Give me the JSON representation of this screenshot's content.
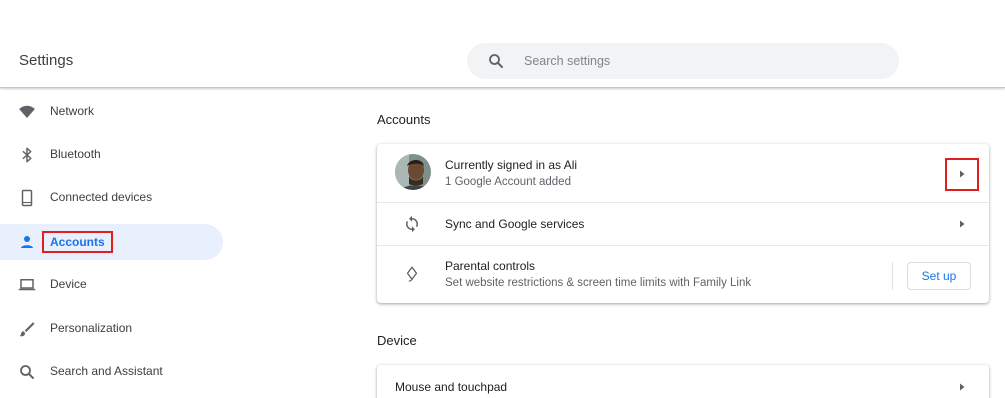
{
  "header": {
    "title": "Settings",
    "search_placeholder": "Search settings"
  },
  "sidebar": {
    "items": [
      {
        "label": "Network",
        "icon": "wifi-icon"
      },
      {
        "label": "Bluetooth",
        "icon": "bluetooth-icon"
      },
      {
        "label": "Connected devices",
        "icon": "phone-icon"
      },
      {
        "label": "Accounts",
        "icon": "person-icon",
        "active": true
      },
      {
        "label": "Device",
        "icon": "laptop-icon"
      },
      {
        "label": "Personalization",
        "icon": "brush-icon"
      },
      {
        "label": "Search and Assistant",
        "icon": "search-icon"
      }
    ]
  },
  "main": {
    "accounts_section": {
      "title": "Accounts",
      "signed_in": {
        "primary": "Currently signed in as Ali",
        "secondary": "1 Google Account added"
      },
      "sync": {
        "primary": "Sync and Google services"
      },
      "parental": {
        "primary": "Parental controls",
        "secondary": "Set website restrictions & screen time limits with Family Link",
        "button": "Set up"
      }
    },
    "device_section": {
      "title": "Device",
      "mouse": {
        "primary": "Mouse and touchpad"
      }
    }
  },
  "colors": {
    "accent": "#1a73e8",
    "active_bg": "#e8f0fe",
    "highlight": "#e02020"
  }
}
